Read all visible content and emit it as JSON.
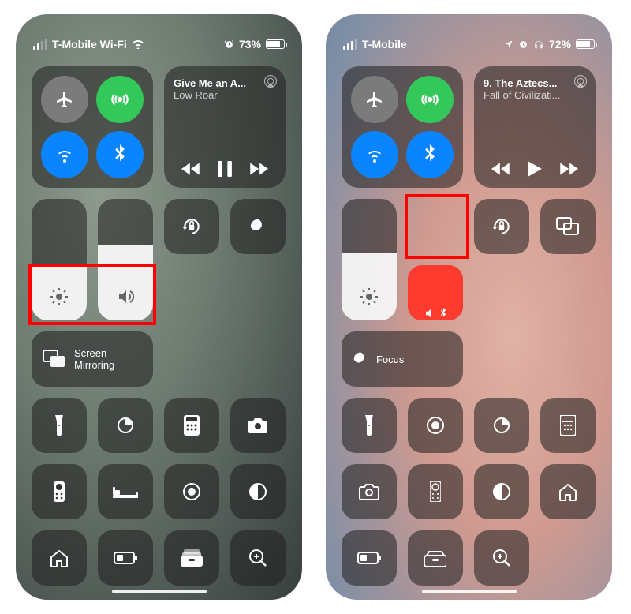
{
  "left": {
    "status": {
      "carrier": "T-Mobile Wi-Fi",
      "battery": "73%"
    },
    "nowplaying": {
      "title": "Give Me an A...",
      "subtitle": "Low Roar"
    },
    "screenMirroring": {
      "label1": "Screen",
      "label2": "Mirroring"
    }
  },
  "right": {
    "status": {
      "carrier": "T-Mobile",
      "battery": "72%"
    },
    "nowplaying": {
      "title": "9. The Aztecs...",
      "subtitle": "Fall of Civilizati..."
    },
    "focus": {
      "label": "Focus"
    }
  }
}
